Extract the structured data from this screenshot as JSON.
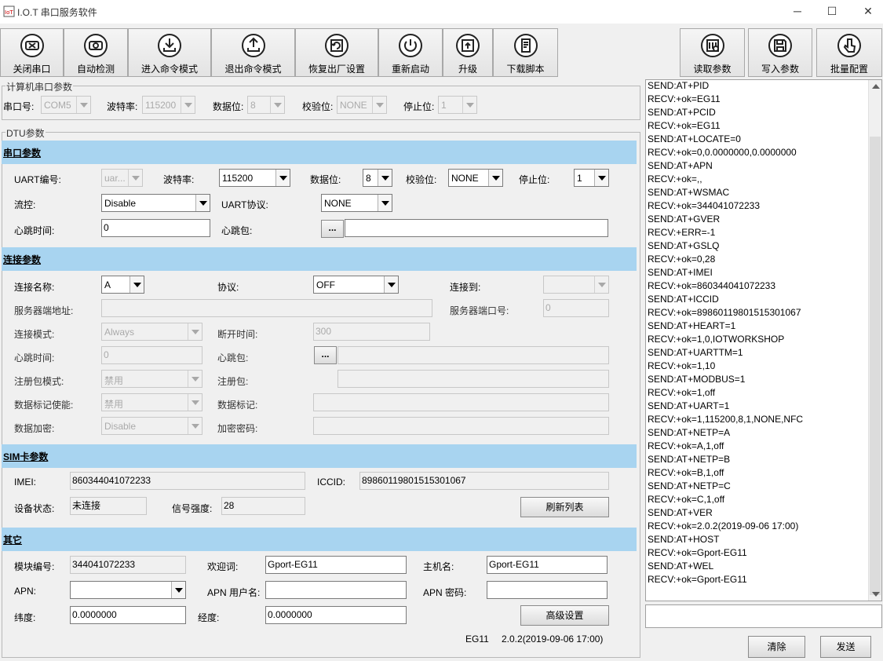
{
  "window": {
    "title": "I.O.T 串口服务软件",
    "minimize": "─",
    "maximize": "☐",
    "close": "✕"
  },
  "toolbar": {
    "close_port": "关闭串口",
    "auto_detect": "自动检测",
    "enter_cmd": "进入命令模式",
    "exit_cmd": "退出命令模式",
    "factory_reset": "恢复出厂设置",
    "restart": "重新启动",
    "upgrade": "升级",
    "download_script": "下载脚本",
    "read_params": "读取参数",
    "write_params": "写入参数",
    "batch_config": "批量配置"
  },
  "pc_port": {
    "group_title": "计算机串口参数",
    "port_label": "串口号:",
    "port_value": "COM5",
    "baud_label": "波特率:",
    "baud_value": "115200",
    "databits_label": "数据位:",
    "databits_value": "8",
    "parity_label": "校验位:",
    "parity_value": "NONE",
    "stopbits_label": "停止位:",
    "stopbits_value": "1"
  },
  "dtu": {
    "group_title": "DTU参数",
    "serial": {
      "section": "串口参数",
      "uart_no_label": "UART编号:",
      "uart_no_value": "uar...",
      "baud_label": "波特率:",
      "baud_value": "115200",
      "databits_label": "数据位:",
      "databits_value": "8",
      "parity_label": "校验位:",
      "parity_value": "NONE",
      "stopbits_label": "停止位:",
      "stopbits_value": "1",
      "flow_label": "流控:",
      "flow_value": "Disable",
      "uart_proto_label": "UART协议:",
      "uart_proto_value": "NONE",
      "hb_time_label": "心跳时间:",
      "hb_time_value": "0",
      "hb_pkt_label": "心跳包:",
      "dots": "...",
      "hb_pkt_value": ""
    },
    "conn": {
      "section": "连接参数",
      "name_label": "连接名称:",
      "name_value": "A",
      "proto_label": "协议:",
      "proto_value": "OFF",
      "connect_to_label": "连接到:",
      "connect_to_value": "",
      "server_addr_label": "服务器端地址:",
      "server_addr_value": "",
      "server_port_label": "服务器端口号:",
      "server_port_value": "0",
      "mode_label": "连接模式:",
      "mode_value": "Always",
      "disconnect_label": "断开时间:",
      "disconnect_value": "300",
      "hb_time_label": "心跳时间:",
      "hb_time_value": "0",
      "hb_pkt_label": "心跳包:",
      "dots": "...",
      "hb_pkt_value": "",
      "reg_mode_label": "注册包模式:",
      "reg_mode_value": "禁用",
      "reg_pkt_label": "注册包:",
      "reg_pkt_value": "",
      "data_tag_en_label": "数据标记使能:",
      "data_tag_en_value": "禁用",
      "data_tag_label": "数据标记:",
      "data_tag_value": "",
      "encrypt_label": "数据加密:",
      "encrypt_value": "Disable",
      "encrypt_pwd_label": "加密密码:",
      "encrypt_pwd_value": ""
    },
    "sim": {
      "section": "SIM卡参数",
      "imei_label": "IMEI:",
      "imei_value": "860344041072233",
      "iccid_label": "ICCID:",
      "iccid_value": "89860119801515301067",
      "state_label": "设备状态:",
      "state_value": "未连接",
      "signal_label": "信号强度:",
      "signal_value": "28",
      "refresh": "刷新列表"
    },
    "other": {
      "section": "其它",
      "module_no_label": "模块编号:",
      "module_no_value": "344041072233",
      "welcome_label": "欢迎词:",
      "welcome_value": "Gport-EG11",
      "host_label": "主机名:",
      "host_value": "Gport-EG11",
      "apn_label": "APN:",
      "apn_value": "",
      "apn_user_label": "APN 用户名:",
      "apn_user_value": "",
      "apn_pwd_label": "APN 密码:",
      "apn_pwd_value": "",
      "lat_label": "纬度:",
      "lat_value": "0.0000000",
      "lon_label": "经度:",
      "lon_value": "0.0000000",
      "advanced": "高级设置",
      "model": "EG11",
      "version": "2.0.2(2019-09-06 17:00)"
    }
  },
  "log": [
    "SEND:AT+PID",
    "RECV:+ok=EG11",
    "SEND:AT+PCID",
    "RECV:+ok=EG11",
    "SEND:AT+LOCATE=0",
    "RECV:+ok=0,0.0000000,0.0000000",
    "SEND:AT+APN",
    "RECV:+ok=,,",
    "SEND:AT+WSMAC",
    "RECV:+ok=344041072233",
    "SEND:AT+GVER",
    "RECV:+ERR=-1",
    "SEND:AT+GSLQ",
    "RECV:+ok=0,28",
    "SEND:AT+IMEI",
    "RECV:+ok=860344041072233",
    "SEND:AT+ICCID",
    "RECV:+ok=89860119801515301067",
    "SEND:AT+HEART=1",
    "RECV:+ok=1,0,IOTWORKSHOP",
    "SEND:AT+UARTTM=1",
    "RECV:+ok=1,10",
    "SEND:AT+MODBUS=1",
    "RECV:+ok=1,off",
    "SEND:AT+UART=1",
    "RECV:+ok=1,115200,8,1,NONE,NFC",
    "SEND:AT+NETP=A",
    "RECV:+ok=A,1,off",
    "SEND:AT+NETP=B",
    "RECV:+ok=B,1,off",
    "SEND:AT+NETP=C",
    "RECV:+ok=C,1,off",
    "SEND:AT+VER",
    "RECV:+ok=2.0.2(2019-09-06 17:00)",
    "SEND:AT+HOST",
    "RECV:+ok=Gport-EG11",
    "SEND:AT+WEL",
    "RECV:+ok=Gport-EG11"
  ],
  "send_input": "",
  "buttons": {
    "clear": "清除",
    "send": "发送"
  }
}
